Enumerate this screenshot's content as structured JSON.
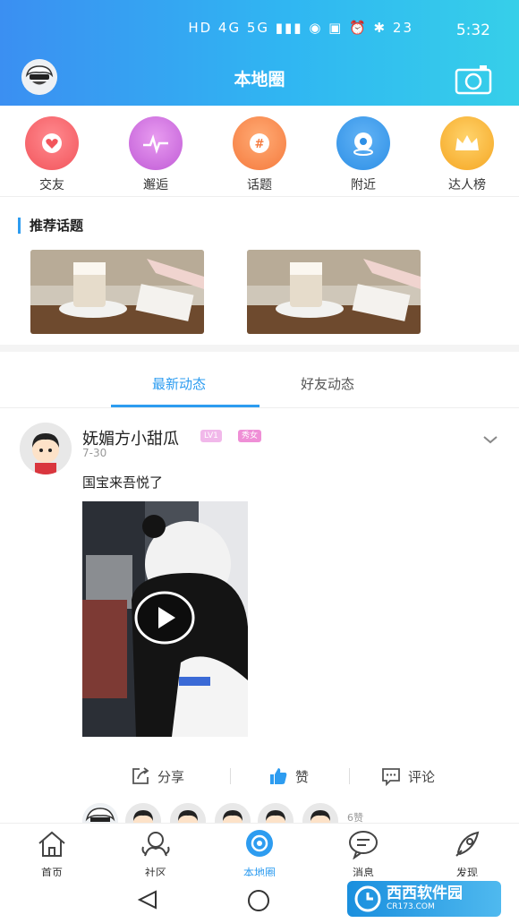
{
  "status_bar": {
    "left_icons": "HD 4G 5G",
    "right_icons": "23",
    "time": "5:32"
  },
  "header": {
    "title": "本地圈",
    "avatar_icon": "cartoon-avatar",
    "camera_icon": "camera-icon",
    "gradient": [
      "#3b8ff2",
      "#36cfe9"
    ]
  },
  "categories": [
    {
      "label": "交友",
      "icon": "heart-icon",
      "color": "#f2545b"
    },
    {
      "label": "邂逅",
      "icon": "pulse-icon",
      "color": "#cf5bd8"
    },
    {
      "label": "话题",
      "icon": "hashtag-icon",
      "color": "#f57a3d"
    },
    {
      "label": "附近",
      "icon": "location-icon",
      "color": "#2d8fe6"
    },
    {
      "label": "达人榜",
      "icon": "crown-icon",
      "color": "#f5b22e"
    }
  ],
  "recommended": {
    "title": "推荐话题"
  },
  "tabs": [
    {
      "label": "最新动态",
      "active": true
    },
    {
      "label": "好友动态",
      "active": false
    }
  ],
  "post": {
    "username": "妩媚方小甜瓜",
    "level_badge": "LV1",
    "gender_badge": "秀女",
    "date": "7-30",
    "text": "国宝来吾悦了",
    "likes_text": "6赞"
  },
  "actions": {
    "share": "分享",
    "like": "赞",
    "comment": "评论"
  },
  "bottom_nav": [
    {
      "label": "首页",
      "icon": "home-icon",
      "active": false
    },
    {
      "label": "社区",
      "icon": "community-icon",
      "active": false
    },
    {
      "label": "本地圈",
      "icon": "local-circle-icon",
      "active": true
    },
    {
      "label": "消息",
      "icon": "message-icon",
      "active": false
    },
    {
      "label": "发现",
      "icon": "rocket-icon",
      "active": false
    }
  ],
  "watermark": {
    "brand": "西西软件园",
    "url": "CR173.COM"
  },
  "accent_color": "#2d9cf0"
}
